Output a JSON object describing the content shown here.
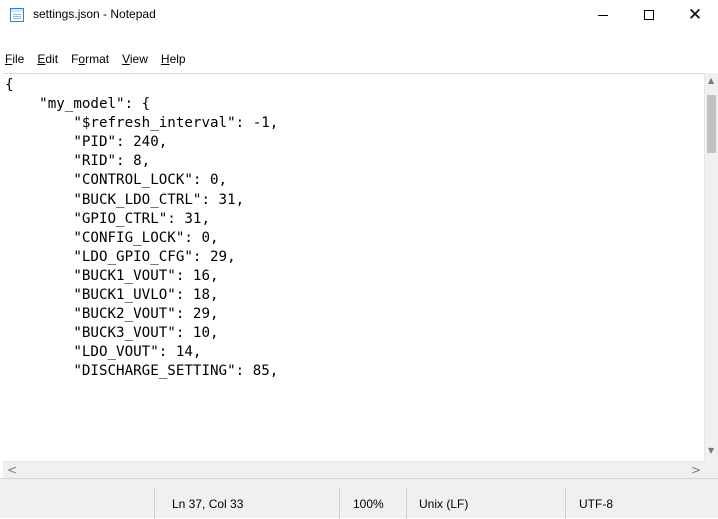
{
  "window": {
    "title": "settings.json - Notepad",
    "app_icon": "notepad-icon",
    "controls": {
      "minimize": "minimize-icon",
      "maximize": "maximize-icon",
      "close_label": "✕"
    }
  },
  "menu": {
    "items": [
      {
        "mnemonic": "F",
        "rest": "ile"
      },
      {
        "mnemonic": "E",
        "rest": "dit"
      },
      {
        "prefix": "F",
        "mnemonic": "o",
        "rest": "rmat"
      },
      {
        "mnemonic": "V",
        "rest": "iew"
      },
      {
        "mnemonic": "H",
        "rest": "elp"
      }
    ]
  },
  "editor": {
    "content": "{\n    \"my_model\": {\n        \"$refresh_interval\": -1,\n        \"PID\": 240,\n        \"RID\": 8,\n        \"CONTROL_LOCK\": 0,\n        \"BUCK_LDO_CTRL\": 31,\n        \"GPIO_CTRL\": 31,\n        \"CONFIG_LOCK\": 0,\n        \"LDO_GPIO_CFG\": 29,\n        \"BUCK1_VOUT\": 16,\n        \"BUCK1_UVLO\": 18,\n        \"BUCK2_VOUT\": 29,\n        \"BUCK3_VOUT\": 10,\n        \"LDO_VOUT\": 14,\n        \"DISCHARGE_SETTING\": 85,"
  },
  "scrollbars": {
    "up_arrow": "▲",
    "down_arrow": "▼",
    "left_arrow": "<",
    "right_arrow": ">"
  },
  "status": {
    "position": "Ln 37, Col 33",
    "zoom": "100%",
    "line_ending": "Unix (LF)",
    "encoding": "UTF-8"
  }
}
